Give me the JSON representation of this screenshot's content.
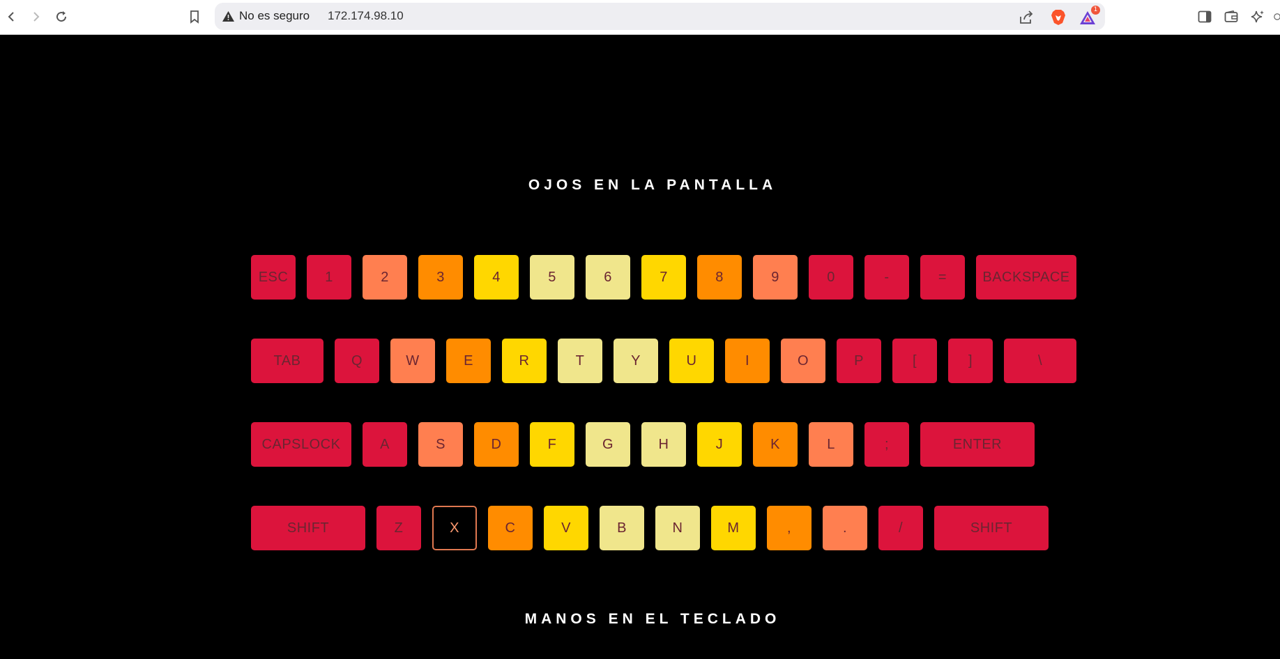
{
  "browser": {
    "security_label": "No es seguro",
    "url": "172.174.98.10",
    "notification_count": "1"
  },
  "page": {
    "top_heading": "OJOS EN LA PANTALLA",
    "bottom_heading": "MANOS EN EL TECLADO"
  },
  "colors": {
    "red": "#dc143c",
    "coral": "#ff7f50",
    "orange": "#ff8c00",
    "gold": "#ffd700",
    "khaki": "#f0e68c",
    "highlight_border": "#e07850"
  },
  "keyboard": {
    "rows": [
      [
        {
          "label": "ESC",
          "color": "red"
        },
        {
          "label": "1",
          "color": "red"
        },
        {
          "label": "2",
          "color": "coral"
        },
        {
          "label": "3",
          "color": "orange"
        },
        {
          "label": "4",
          "color": "gold"
        },
        {
          "label": "5",
          "color": "khaki"
        },
        {
          "label": "6",
          "color": "khaki"
        },
        {
          "label": "7",
          "color": "gold"
        },
        {
          "label": "8",
          "color": "orange"
        },
        {
          "label": "9",
          "color": "coral"
        },
        {
          "label": "0",
          "color": "red"
        },
        {
          "label": "-",
          "color": "red"
        },
        {
          "label": "=",
          "color": "red"
        },
        {
          "label": "BACKSPACE",
          "color": "red",
          "size": "xl"
        }
      ],
      [
        {
          "label": "TAB",
          "color": "red",
          "size": "m"
        },
        {
          "label": "Q",
          "color": "red"
        },
        {
          "label": "W",
          "color": "coral"
        },
        {
          "label": "E",
          "color": "orange"
        },
        {
          "label": "R",
          "color": "gold"
        },
        {
          "label": "T",
          "color": "khaki"
        },
        {
          "label": "Y",
          "color": "khaki"
        },
        {
          "label": "U",
          "color": "gold"
        },
        {
          "label": "I",
          "color": "orange"
        },
        {
          "label": "O",
          "color": "coral"
        },
        {
          "label": "P",
          "color": "red"
        },
        {
          "label": "[",
          "color": "red"
        },
        {
          "label": "]",
          "color": "red"
        },
        {
          "label": "\\",
          "color": "red",
          "size": "m"
        }
      ],
      [
        {
          "label": "CAPSLOCK",
          "color": "red",
          "size": "xl"
        },
        {
          "label": "A",
          "color": "red"
        },
        {
          "label": "S",
          "color": "coral"
        },
        {
          "label": "D",
          "color": "orange"
        },
        {
          "label": "F",
          "color": "gold"
        },
        {
          "label": "G",
          "color": "khaki"
        },
        {
          "label": "H",
          "color": "khaki"
        },
        {
          "label": "J",
          "color": "gold"
        },
        {
          "label": "K",
          "color": "orange"
        },
        {
          "label": "L",
          "color": "coral"
        },
        {
          "label": ";",
          "color": "red"
        },
        {
          "label": "ENTER",
          "color": "red",
          "size": "xxl"
        }
      ],
      [
        {
          "label": "SHIFT",
          "color": "red",
          "size": "xxl"
        },
        {
          "label": "Z",
          "color": "red"
        },
        {
          "label": "X",
          "color": "coral",
          "highlighted": true
        },
        {
          "label": "C",
          "color": "orange"
        },
        {
          "label": "V",
          "color": "gold"
        },
        {
          "label": "B",
          "color": "khaki"
        },
        {
          "label": "N",
          "color": "khaki"
        },
        {
          "label": "M",
          "color": "gold"
        },
        {
          "label": ",",
          "color": "orange"
        },
        {
          "label": ".",
          "color": "coral"
        },
        {
          "label": "/",
          "color": "red"
        },
        {
          "label": "SHIFT",
          "color": "red",
          "size": "xxl"
        }
      ]
    ]
  }
}
